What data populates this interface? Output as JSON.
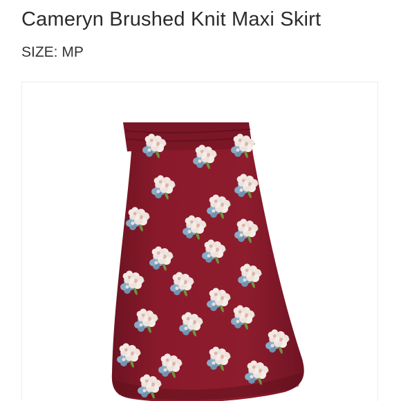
{
  "product": {
    "title": "Cameryn Brushed Knit Maxi Skirt",
    "size_label": "SIZE:",
    "size_value": "MP"
  },
  "colors": {
    "skirt": "#8a1a2b",
    "skirt_shadow": "#6e1322",
    "petal": "#f4e9e4",
    "blue_flower": "#7fa3c0",
    "leaf": "#7fa24a"
  },
  "icons": {
    "product_image": "floral-maxi-skirt-photo"
  }
}
